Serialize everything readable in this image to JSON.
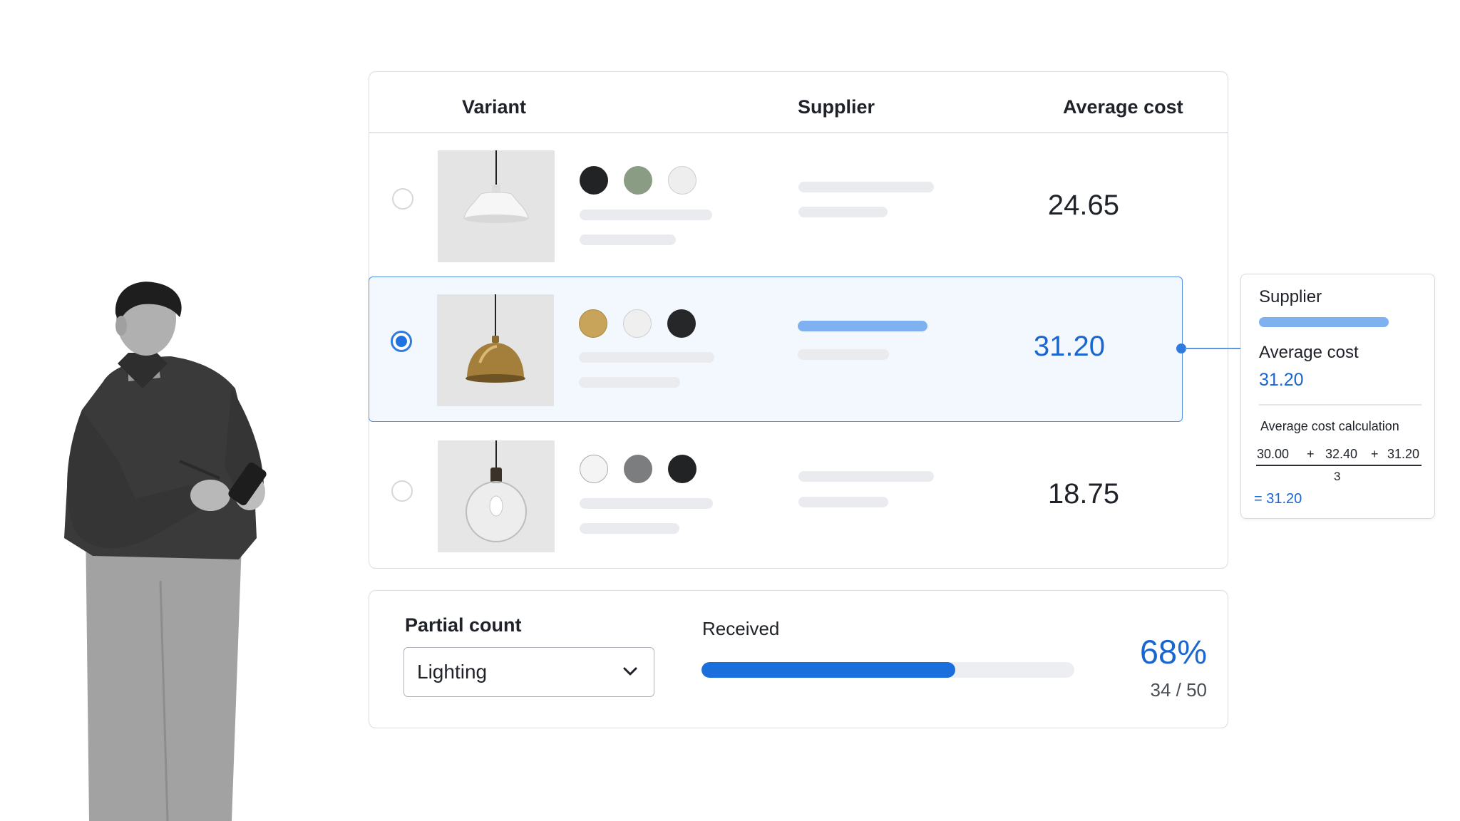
{
  "table": {
    "headers": {
      "variant": "Variant",
      "supplier": "Supplier",
      "average_cost": "Average cost"
    },
    "rows": [
      {
        "average_cost": "24.65",
        "selected": false,
        "product": "white-pendant-lamp",
        "swatches": [
          "#222324",
          "#8a9c83",
          "#eeeeee"
        ]
      },
      {
        "average_cost": "31.20",
        "selected": true,
        "product": "brass-dome-pendant-lamp",
        "swatches": [
          "#c7a45a",
          "#efefef",
          "#262728"
        ]
      },
      {
        "average_cost": "18.75",
        "selected": false,
        "product": "glass-globe-pendant-lamp",
        "swatches": [
          "#f4f4f4",
          "#7c7d7f",
          "#222324"
        ]
      }
    ]
  },
  "detail_panel": {
    "supplier_label": "Supplier",
    "average_cost_label": "Average cost",
    "average_cost_value": "31.20",
    "calculation_label": "Average cost calculation",
    "operands": [
      "30.00",
      "32.40",
      "31.20"
    ],
    "operator": "+",
    "divisor": "3",
    "result": "= 31.20"
  },
  "partial_count": {
    "title": "Partial count",
    "select_value": "Lighting",
    "received_label": "Received",
    "percent_text": "68%",
    "progress_fraction": 0.68,
    "count_text": "34 / 50"
  },
  "colors": {
    "accent": "#1a6fdc",
    "selected_row_bg": "#f3f8fe",
    "selected_row_border": "#4d8fe6"
  },
  "icons": {
    "select_arrow": "chevron-down-icon"
  }
}
